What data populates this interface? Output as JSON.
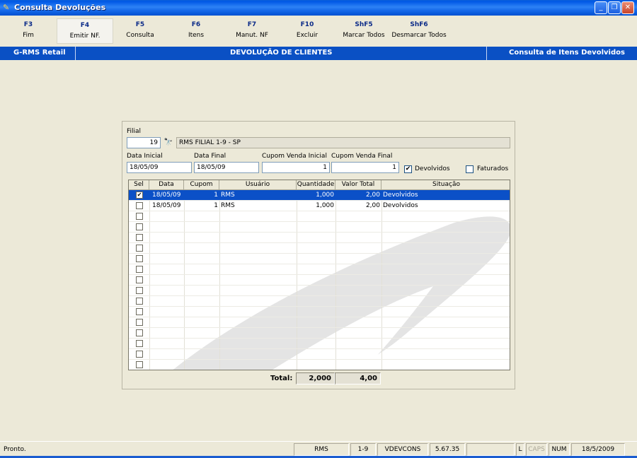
{
  "window": {
    "title": "Consulta Devoluções"
  },
  "fkeys": [
    {
      "key": "F3",
      "label": "Fim"
    },
    {
      "key": "F4",
      "label": "Emitir NF."
    },
    {
      "key": "F5",
      "label": "Consulta"
    },
    {
      "key": "F6",
      "label": "Itens"
    },
    {
      "key": "F7",
      "label": "Manut. NF"
    },
    {
      "key": "F10",
      "label": "Excluir"
    },
    {
      "key": "ShF5",
      "label": "Marcar Todos"
    },
    {
      "key": "ShF6",
      "label": "Desmarcar Todos"
    }
  ],
  "header": {
    "left": "G-RMS Retail",
    "center": "DEVOLUÇÃO DE CLIENTES",
    "right": "Consulta de Itens Devolvidos"
  },
  "form": {
    "filial_label": "Filial",
    "filial_value": "19",
    "filial_desc": "RMS FILIAL 1-9 - SP",
    "data_inicial_label": "Data Inicial",
    "data_inicial": "18/05/09",
    "data_final_label": "Data Final",
    "data_final": "18/05/09",
    "cupom_ini_label": "Cupom Venda Inicial",
    "cupom_ini": "1",
    "cupom_fim_label": "Cupom Venda Final",
    "cupom_fim": "1",
    "devolvidos_label": "Devolvidos",
    "devolvidos_checked": true,
    "faturados_label": "Faturados",
    "faturados_checked": false
  },
  "grid": {
    "columns": [
      "Sel",
      "Data",
      "Cupom",
      "Usuário",
      "Quantidade",
      "Valor Total",
      "Situação"
    ],
    "rows": [
      {
        "sel": true,
        "data": "18/05/09",
        "cupom": "1",
        "usuario": "RMS",
        "quantidade": "1,000",
        "valor": "2,00",
        "situacao": "Devolvidos"
      },
      {
        "sel": false,
        "data": "18/05/09",
        "cupom": "1",
        "usuario": "RMS",
        "quantidade": "1,000",
        "valor": "2,00",
        "situacao": "Devolvidos"
      }
    ]
  },
  "totals": {
    "label": "Total:",
    "quantidade": "2,000",
    "valor": "4,00"
  },
  "statusbar": {
    "message": "Pronto.",
    "user": "RMS",
    "filial": "1-9",
    "program": "VDEVCONS",
    "version": "5.67.35",
    "l": "L",
    "caps": "CAPS",
    "num": "NUM",
    "date": "18/5/2009"
  }
}
